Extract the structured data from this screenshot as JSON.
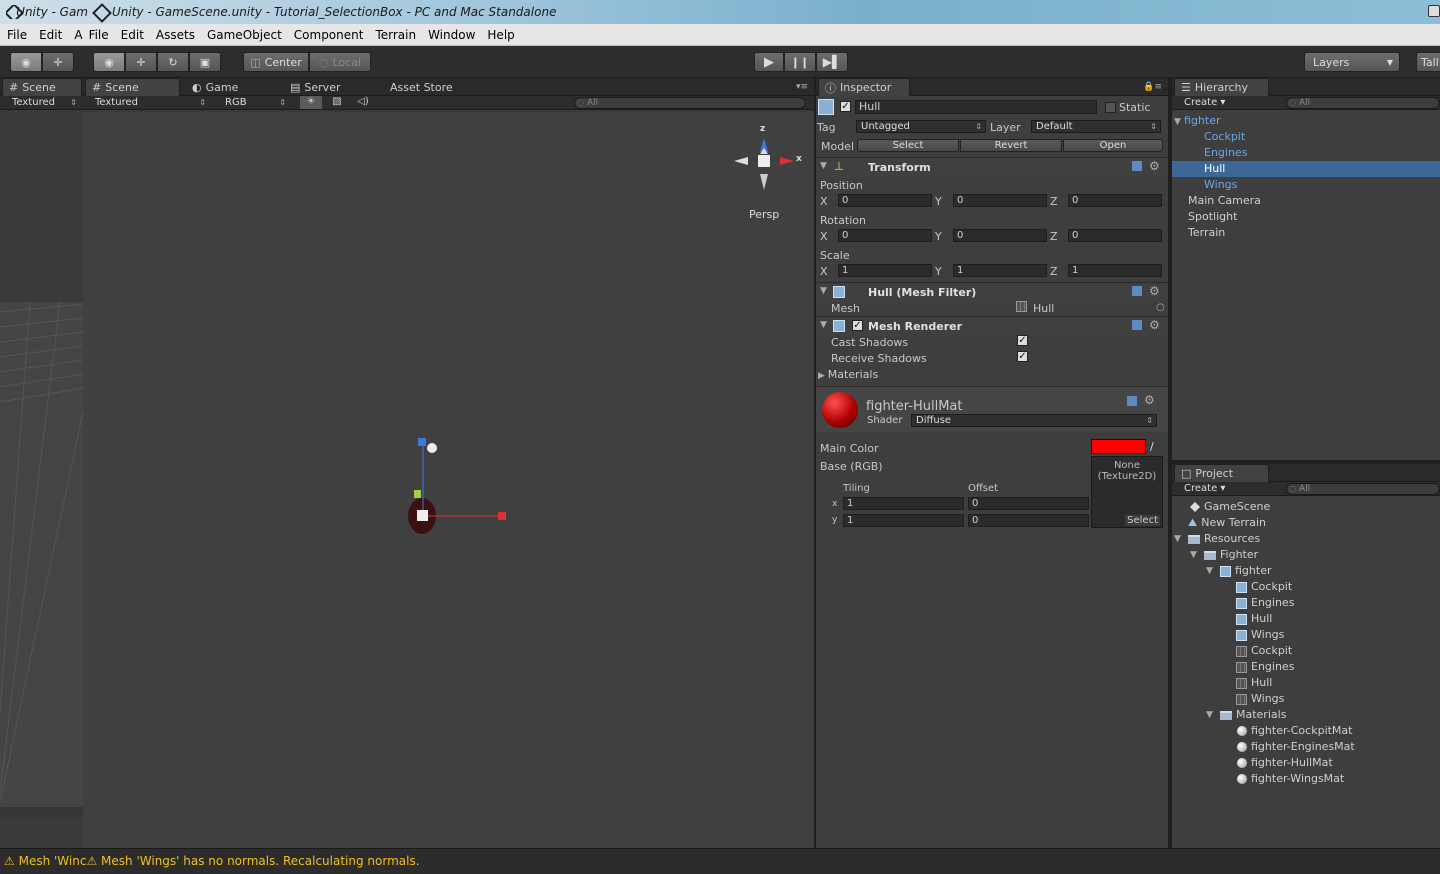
{
  "titlebar": {
    "tab1": "Unity - Gam",
    "title": "Unity - GameScene.unity - Tutorial_SelectionBox - PC and Mac Standalone"
  },
  "menubar": {
    "items": [
      "File",
      "Edit",
      "A",
      "File",
      "Edit",
      "Assets",
      "GameObject",
      "Component",
      "Terrain",
      "Window",
      "Help"
    ]
  },
  "toolbar": {
    "pivot": "Center",
    "space": "Local",
    "layers": "Layers",
    "layout": "Tall"
  },
  "scene1": {
    "tab": "Scene",
    "mode": "Textured"
  },
  "scene2": {
    "tab": "Scene",
    "mode": "Textured",
    "channel": "RGB"
  },
  "tabs": {
    "game": "Game",
    "server": "Server",
    "asset_store": "Asset Store",
    "search": "All"
  },
  "gizmo": {
    "z": "z",
    "x": "x",
    "view": "Persp"
  },
  "inspector": {
    "tab": "Inspector",
    "name": "Hull",
    "static_label": "Static",
    "tag_label": "Tag",
    "tag_value": "Untagged",
    "layer_label": "Layer",
    "layer_value": "Default",
    "model_label": "Model",
    "model_buttons": [
      "Select",
      "Revert",
      "Open"
    ],
    "transform": {
      "title": "Transform",
      "position_label": "Position",
      "rotation_label": "Rotation",
      "scale_label": "Scale",
      "axes": [
        "X",
        "Y",
        "Z"
      ],
      "position": [
        "0",
        "0",
        "0"
      ],
      "rotation": [
        "0",
        "0",
        "0"
      ],
      "scale": [
        "1",
        "1",
        "1"
      ]
    },
    "mesh_filter": {
      "title": "Hull (Mesh Filter)",
      "mesh_label": "Mesh",
      "mesh_value": "Hull"
    },
    "mesh_renderer": {
      "title": "Mesh Renderer",
      "cast": "Cast Shadows",
      "receive": "Receive Shadows",
      "materials": "Materials"
    },
    "material": {
      "name": "fighter-HullMat",
      "shader_label": "Shader",
      "shader_value": "Diffuse",
      "main_color_label": "Main Color",
      "base_label": "Base (RGB)",
      "texture_none": "None",
      "texture_type": "(Texture2D)",
      "select": "Select",
      "tiling_label": "Tiling",
      "offset_label": "Offset",
      "x_label": "x",
      "y_label": "y",
      "tiling": [
        "1",
        "1"
      ],
      "offset": [
        "0",
        "0"
      ],
      "color": "#ff0000"
    }
  },
  "hierarchy": {
    "tab": "Hierarchy",
    "create": "Create",
    "search": "All",
    "root": "fighter",
    "children": [
      "Cockpit",
      "Engines",
      "Hull",
      "Wings"
    ],
    "others": [
      "Main Camera",
      "Spotlight",
      "Terrain"
    ]
  },
  "project": {
    "tab": "Project",
    "create": "Create",
    "search": "All",
    "items": [
      {
        "label": "GameScene",
        "icon": "scene-icon"
      },
      {
        "label": "New Terrain",
        "icon": "terrain-icon"
      },
      {
        "label": "Resources",
        "icon": "folder-icon"
      },
      {
        "label": "Fighter",
        "icon": "folder-icon"
      },
      {
        "label": "fighter",
        "icon": "prefab-icon"
      },
      {
        "label": "Cockpit",
        "icon": "mesh-icon"
      },
      {
        "label": "Engines",
        "icon": "mesh-icon"
      },
      {
        "label": "Hull",
        "icon": "mesh-icon"
      },
      {
        "label": "Wings",
        "icon": "mesh-icon"
      },
      {
        "label": "Cockpit",
        "icon": "grid-mesh-icon"
      },
      {
        "label": "Engines",
        "icon": "grid-mesh-icon"
      },
      {
        "label": "Hull",
        "icon": "grid-mesh-icon"
      },
      {
        "label": "Wings",
        "icon": "grid-mesh-icon"
      },
      {
        "label": "Materials",
        "icon": "folder-icon"
      },
      {
        "label": "fighter-CockpitMat",
        "icon": "material-icon"
      },
      {
        "label": "fighter-EnginesMat",
        "icon": "material-icon"
      },
      {
        "label": "fighter-HullMat",
        "icon": "material-icon"
      },
      {
        "label": "fighter-WingsMat",
        "icon": "material-icon"
      }
    ]
  },
  "status": {
    "msg1": "Mesh 'Winc",
    "msg2": "Mesh 'Wings' has no normals. Recalculating normals."
  },
  "colors": {
    "accent": "#3c6797",
    "warning": "#f0c020",
    "hierarchy_blue": "#6aa6ea"
  }
}
